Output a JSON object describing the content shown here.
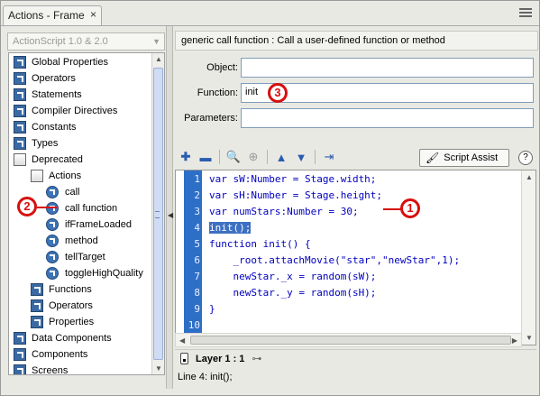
{
  "window": {
    "tab_title": "Actions - Frame",
    "close_glyph": "×"
  },
  "left": {
    "version_select": "ActionScript 1.0 & 2.0",
    "tree": [
      {
        "label": "Global Properties",
        "icon": "book"
      },
      {
        "label": "Operators",
        "icon": "book"
      },
      {
        "label": "Statements",
        "icon": "book"
      },
      {
        "label": "Compiler Directives",
        "icon": "book"
      },
      {
        "label": "Constants",
        "icon": "book"
      },
      {
        "label": "Types",
        "icon": "book"
      },
      {
        "label": "Deprecated",
        "icon": "open-book"
      },
      {
        "label": "Actions",
        "icon": "open-book"
      },
      {
        "label": "call",
        "icon": "action"
      },
      {
        "label": "call function",
        "icon": "action"
      },
      {
        "label": "ifFrameLoaded",
        "icon": "action"
      },
      {
        "label": "method",
        "icon": "action"
      },
      {
        "label": "tellTarget",
        "icon": "action"
      },
      {
        "label": "toggleHighQuality",
        "icon": "action"
      },
      {
        "label": "Functions",
        "icon": "book"
      },
      {
        "label": "Operators",
        "icon": "book"
      },
      {
        "label": "Properties",
        "icon": "book"
      },
      {
        "label": "Data Components",
        "icon": "book"
      },
      {
        "label": "Components",
        "icon": "book"
      },
      {
        "label": "Screens",
        "icon": "book"
      }
    ]
  },
  "right": {
    "description": "generic call function : Call a user-defined function or method",
    "fields": {
      "object_label": "Object:",
      "object_value": "",
      "function_label": "Function:",
      "function_value": "init",
      "parameters_label": "Parameters:",
      "parameters_value": ""
    },
    "script_assist": "Script Assist",
    "help": "?",
    "code": {
      "line_numbers": [
        "1",
        "2",
        "3",
        "4",
        "5",
        "6",
        "7",
        "8",
        "9",
        "10"
      ],
      "lines": [
        "var sW:Number = Stage.width;",
        "var sH:Number = Stage.height;",
        "var numStars:Number = 30;",
        "init();",
        "function init() {",
        "    _root.attachMovie(\"star\",\"newStar\",1);",
        "    newStar._x = random(sW);",
        "    newStar._y = random(sH);",
        "}",
        ""
      ]
    },
    "layer_label": "Layer 1 : 1",
    "status": "Line 4: init();"
  },
  "callouts": [
    "1",
    "2",
    "3"
  ],
  "colors": {
    "gutter": "#2d6fc7",
    "callout": "#d80f0f",
    "keyword": "#0000ff"
  }
}
